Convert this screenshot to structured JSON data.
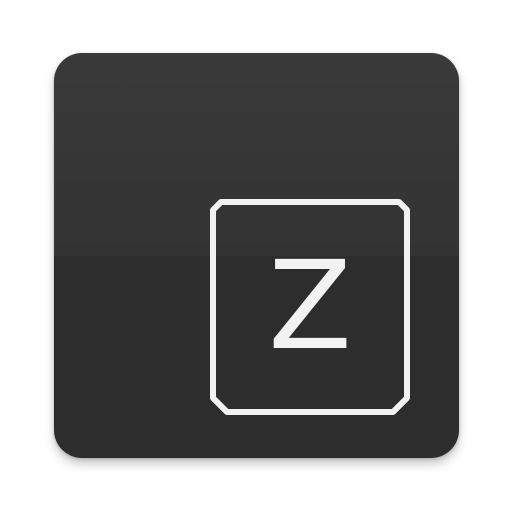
{
  "app_icon": {
    "key_letter": "Z",
    "icon_name": "keyboard-key-icon",
    "colors": {
      "background": "#2f2f2f",
      "key_outline": "#f2f2f2",
      "letter": "#f2f2f2"
    }
  }
}
